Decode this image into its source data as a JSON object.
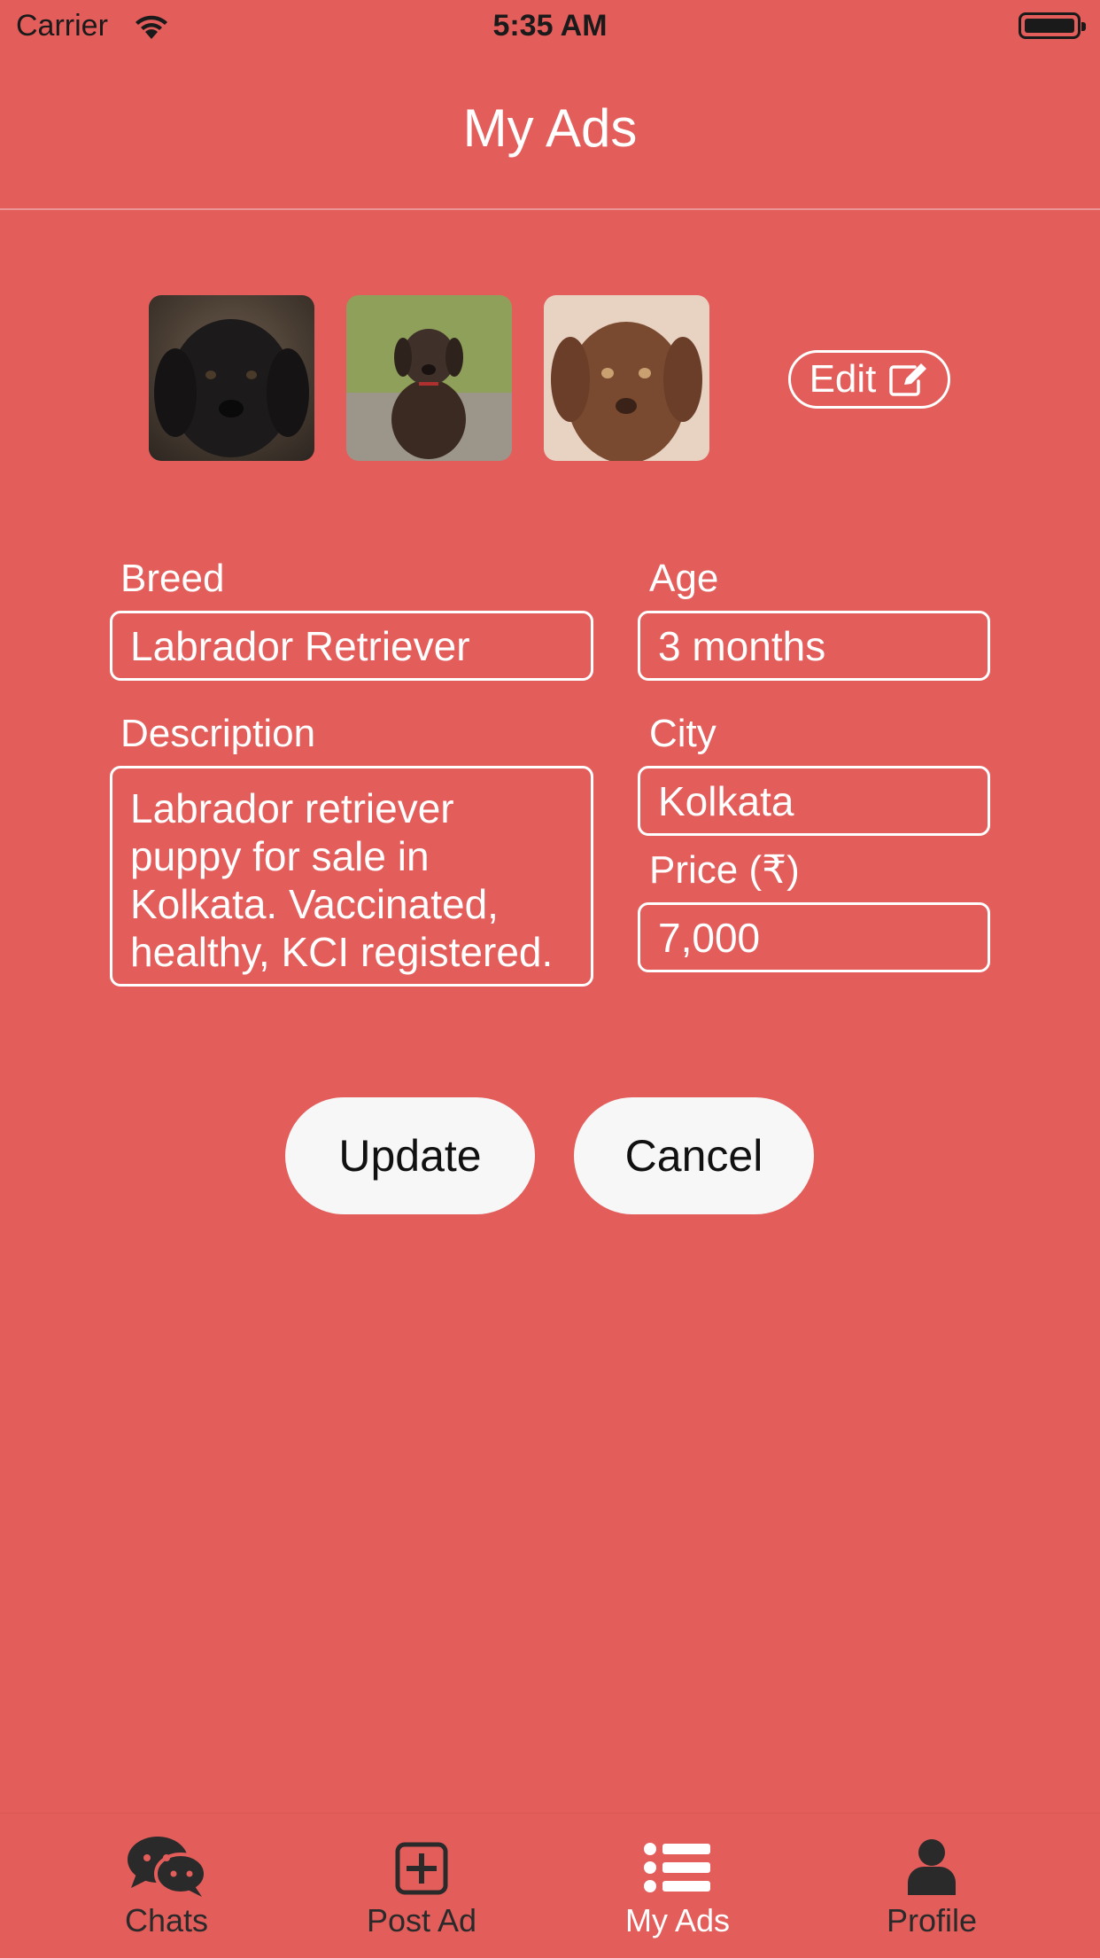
{
  "status_bar": {
    "carrier": "Carrier",
    "time": "5:35 AM"
  },
  "header": {
    "title": "My Ads"
  },
  "photos": [
    {
      "description": "black-labrador-puppy-face"
    },
    {
      "description": "chocolate-labrador-puppy-sitting"
    },
    {
      "description": "chocolate-labrador-puppy-face"
    }
  ],
  "edit_button": {
    "label": "Edit",
    "icon": "edit-pencil-icon"
  },
  "form": {
    "breed": {
      "label": "Breed",
      "value": "Labrador Retriever"
    },
    "age": {
      "label": "Age",
      "value": "3 months"
    },
    "description": {
      "label": "Description",
      "value": "Labrador retriever puppy for sale in Kolkata. Vaccinated, healthy, KCI registered."
    },
    "city": {
      "label": "City",
      "value": "Kolkata"
    },
    "price": {
      "label": "Price (₹)",
      "value": "7,000"
    }
  },
  "actions": {
    "update_label": "Update",
    "cancel_label": "Cancel"
  },
  "tab_bar": {
    "tabs": [
      {
        "label": "Chats",
        "icon": "chat-bubbles-icon"
      },
      {
        "label": "Post Ad",
        "icon": "plus-square-icon"
      },
      {
        "label": "My Ads",
        "icon": "list-icon"
      },
      {
        "label": "Profile",
        "icon": "person-icon"
      }
    ],
    "active_tab": "My Ads"
  },
  "colors": {
    "background": "#e35d5b",
    "button_bg": "#f7f7f7",
    "inactive_tab": "#2a2a2a",
    "active_tab": "#ffffff"
  }
}
